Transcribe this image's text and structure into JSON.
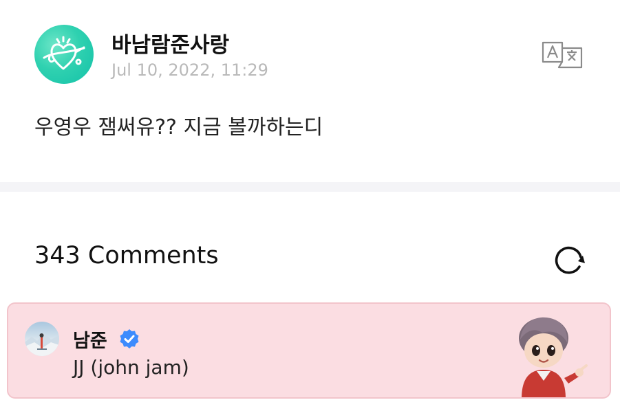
{
  "post": {
    "author": "바남람준사랑",
    "date": "Jul 10, 2022, 11:29",
    "body": "우영우 잼써유?? 지금 볼까하는디",
    "avatar_icon": "heart-doodle-avatar",
    "translate_icon": "translate-icon"
  },
  "comments": {
    "count_label": "343 Comments",
    "refresh_icon": "refresh-icon",
    "pinned": {
      "author": "남준",
      "verified": true,
      "text": "JJ (john jam)",
      "sticker": "tinytan-rm-sticker",
      "background": "#fbdde2"
    }
  },
  "colors": {
    "avatar_teal": "#2fd1b0",
    "date_gray": "#b9b9b9",
    "verified_blue": "#3d8bfd",
    "divider": "#f4f4f7"
  }
}
